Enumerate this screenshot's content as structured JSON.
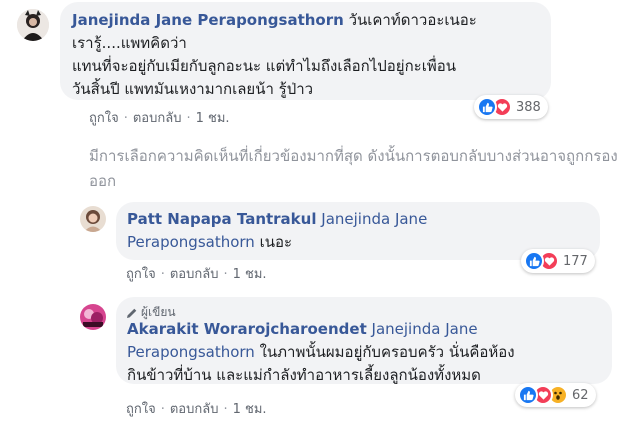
{
  "comments": [
    {
      "author": "Janejinda Jane Perapongsathorn",
      "text_first": "วันเคาท์ดาวอะเนอะ",
      "lines": [
        "เรารู้....แพทคิดว่า",
        "แทนที่จะอยู่กับเมียกับลูกอะนะ แต่ทำไมถึงเลือกไปอยู่กะเพื่อน",
        "วันสิ้นปี แพทมันเหงามากเลยน้า รู้ป่าว"
      ],
      "like": "ถูกใจ",
      "reply": "ตอบกลับ",
      "time": "1 ชม.",
      "reaction_count": "388"
    }
  ],
  "note": "มีการเลือกความคิดเห็นที่เกี่ยวข้องมากที่สุด ดังนั้นการตอบกลับบางส่วนอาจถูกกรองออก",
  "replies": [
    {
      "author": "Patt Napapa Tantrakul",
      "tag_first": "Janejinda Jane",
      "tag_second": "Perapongsathorn",
      "text": "เนอะ",
      "like": "ถูกใจ",
      "reply": "ตอบกลับ",
      "time": "1 ชม.",
      "reaction_count": "177"
    },
    {
      "badge": "ผู้เขียน",
      "author": "Akarakit Worarojcharoendet",
      "tag_first": "Janejinda Jane",
      "tag_second": "Perapongsathorn",
      "text_first": "ในภาพนั้นผมอยู่กับครอบครัว นั่นคือห้อง",
      "text_second": "กินข้าวที่บ้าน และแม่กำลังทำอาหารเลี้ยงลูกน้องทั้งหมด",
      "like": "ถูกใจ",
      "reply": "ตอบกลับ",
      "time": "1 ชม.",
      "reaction_count": "62"
    }
  ],
  "icons": {
    "like": "like-reaction-icon",
    "love": "love-reaction-icon",
    "wow": "wow-reaction-icon",
    "pen": "pen-icon"
  },
  "colors": {
    "author": "#385898",
    "bubble": "#f2f3f5",
    "like": "#1877f2",
    "love": "#f33e58",
    "wow": "#f7b125"
  }
}
